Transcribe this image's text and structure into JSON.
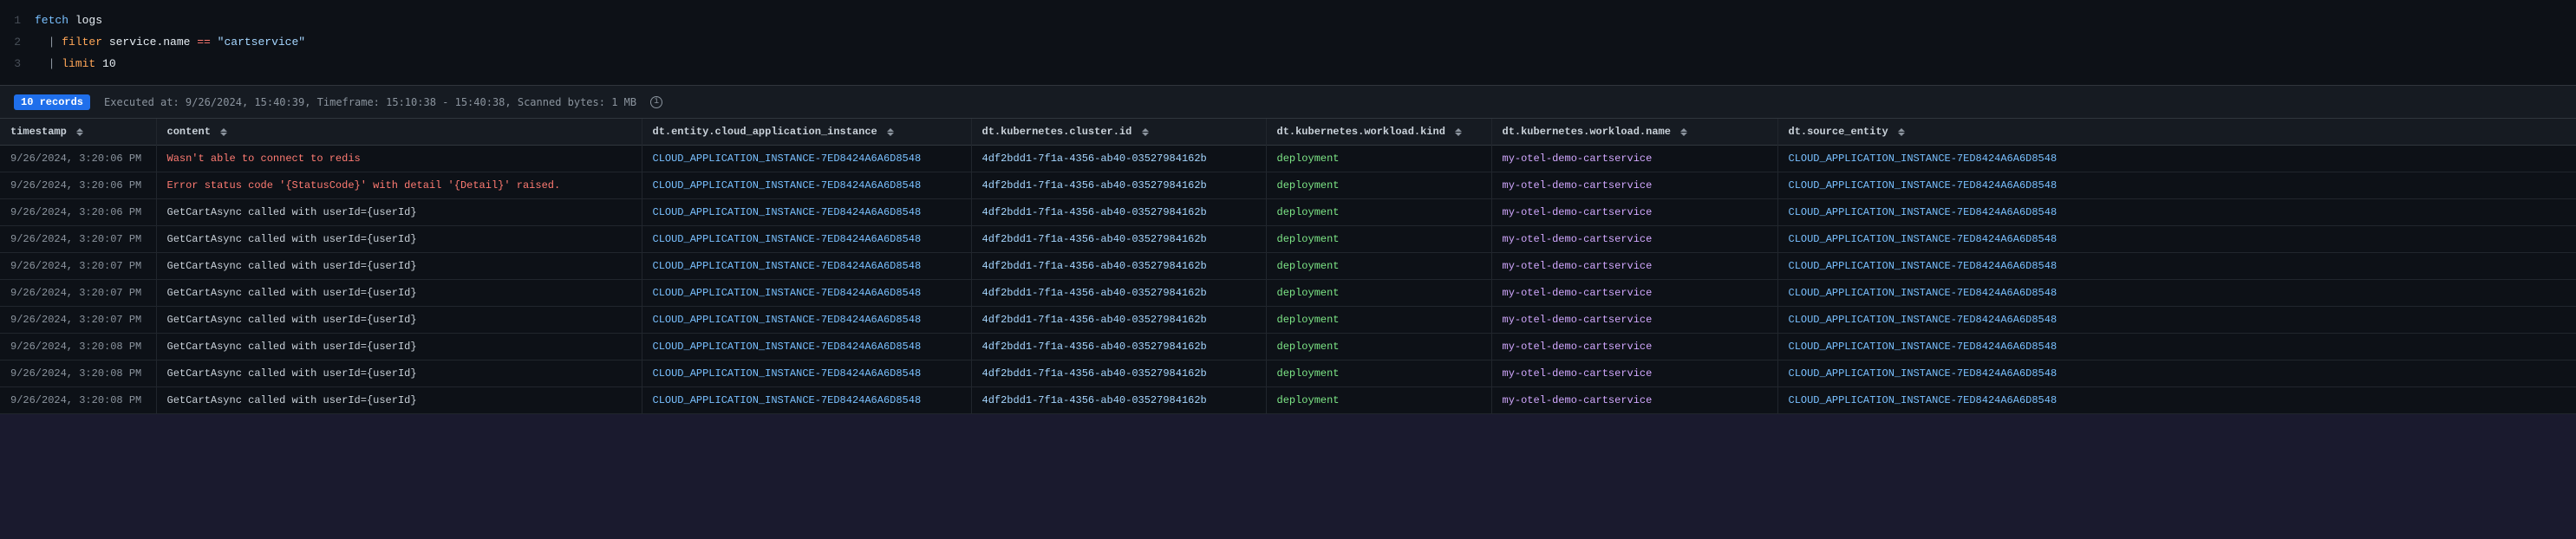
{
  "editor": {
    "lines": [
      {
        "number": "1",
        "tokens": [
          {
            "text": "fetch",
            "class": "kw-blue"
          },
          {
            "text": " logs",
            "class": "kw-white"
          }
        ]
      },
      {
        "number": "2",
        "tokens": [
          {
            "text": "  | ",
            "class": "kw-pipe"
          },
          {
            "text": "filter",
            "class": "kw-orange"
          },
          {
            "text": " service.name ",
            "class": "kw-white"
          },
          {
            "text": "==",
            "class": "kw-operator"
          },
          {
            "text": " \"cartservice\"",
            "class": "kw-string"
          }
        ]
      },
      {
        "number": "3",
        "tokens": [
          {
            "text": "  | ",
            "class": "kw-pipe"
          },
          {
            "text": "limit",
            "class": "kw-orange"
          },
          {
            "text": " 10",
            "class": "kw-white"
          }
        ]
      }
    ]
  },
  "statusBar": {
    "records": "10 records",
    "executed": "Executed at: 9/26/2024, 15:40:39, Timeframe: 15:10:38 - 15:40:38, Scanned bytes: 1 MB"
  },
  "table": {
    "columns": [
      {
        "id": "timestamp",
        "label": "timestamp"
      },
      {
        "id": "content",
        "label": "content"
      },
      {
        "id": "cloud_app",
        "label": "dt.entity.cloud_application_instance"
      },
      {
        "id": "cluster",
        "label": "dt.kubernetes.cluster.id"
      },
      {
        "id": "workload_kind",
        "label": "dt.kubernetes.workload.kind"
      },
      {
        "id": "workload_name",
        "label": "dt.kubernetes.workload.name"
      },
      {
        "id": "source",
        "label": "dt.source_entity"
      }
    ],
    "rows": [
      {
        "timestamp": "9/26/2024, 3:20:06 PM",
        "content": "Wasn't able to connect to redis",
        "cloud_app": "CLOUD_APPLICATION_INSTANCE-7ED8424A6A6D8548",
        "cluster": "4df2bdd1-7f1a-4356-ab40-03527984162b",
        "workload_kind": "deployment",
        "workload_name": "my-otel-demo-cartservice",
        "source": "CLOUD_APPLICATION_INSTANCE-7ED8424A6A6D8548"
      },
      {
        "timestamp": "9/26/2024, 3:20:06 PM",
        "content": "Error status code '{StatusCode}' with detail '{Detail}' raised.",
        "cloud_app": "CLOUD_APPLICATION_INSTANCE-7ED8424A6A6D8548",
        "cluster": "4df2bdd1-7f1a-4356-ab40-03527984162b",
        "workload_kind": "deployment",
        "workload_name": "my-otel-demo-cartservice",
        "source": "CLOUD_APPLICATION_INSTANCE-7ED8424A6A6D8548"
      },
      {
        "timestamp": "9/26/2024, 3:20:06 PM",
        "content": "GetCartAsync called with userId={userId}",
        "cloud_app": "CLOUD_APPLICATION_INSTANCE-7ED8424A6A6D8548",
        "cluster": "4df2bdd1-7f1a-4356-ab40-03527984162b",
        "workload_kind": "deployment",
        "workload_name": "my-otel-demo-cartservice",
        "source": "CLOUD_APPLICATION_INSTANCE-7ED8424A6A6D8548"
      },
      {
        "timestamp": "9/26/2024, 3:20:07 PM",
        "content": "GetCartAsync called with userId={userId}",
        "cloud_app": "CLOUD_APPLICATION_INSTANCE-7ED8424A6A6D8548",
        "cluster": "4df2bdd1-7f1a-4356-ab40-03527984162b",
        "workload_kind": "deployment",
        "workload_name": "my-otel-demo-cartservice",
        "source": "CLOUD_APPLICATION_INSTANCE-7ED8424A6A6D8548"
      },
      {
        "timestamp": "9/26/2024, 3:20:07 PM",
        "content": "GetCartAsync called with userId={userId}",
        "cloud_app": "CLOUD_APPLICATION_INSTANCE-7ED8424A6A6D8548",
        "cluster": "4df2bdd1-7f1a-4356-ab40-03527984162b",
        "workload_kind": "deployment",
        "workload_name": "my-otel-demo-cartservice",
        "source": "CLOUD_APPLICATION_INSTANCE-7ED8424A6A6D8548"
      },
      {
        "timestamp": "9/26/2024, 3:20:07 PM",
        "content": "GetCartAsync called with userId={userId}",
        "cloud_app": "CLOUD_APPLICATION_INSTANCE-7ED8424A6A6D8548",
        "cluster": "4df2bdd1-7f1a-4356-ab40-03527984162b",
        "workload_kind": "deployment",
        "workload_name": "my-otel-demo-cartservice",
        "source": "CLOUD_APPLICATION_INSTANCE-7ED8424A6A6D8548"
      },
      {
        "timestamp": "9/26/2024, 3:20:07 PM",
        "content": "GetCartAsync called with userId={userId}",
        "cloud_app": "CLOUD_APPLICATION_INSTANCE-7ED8424A6A6D8548",
        "cluster": "4df2bdd1-7f1a-4356-ab40-03527984162b",
        "workload_kind": "deployment",
        "workload_name": "my-otel-demo-cartservice",
        "source": "CLOUD_APPLICATION_INSTANCE-7ED8424A6A6D8548"
      },
      {
        "timestamp": "9/26/2024, 3:20:08 PM",
        "content": "GetCartAsync called with userId={userId}",
        "cloud_app": "CLOUD_APPLICATION_INSTANCE-7ED8424A6A6D8548",
        "cluster": "4df2bdd1-7f1a-4356-ab40-03527984162b",
        "workload_kind": "deployment",
        "workload_name": "my-otel-demo-cartservice",
        "source": "CLOUD_APPLICATION_INSTANCE-7ED8424A6A6D8548"
      },
      {
        "timestamp": "9/26/2024, 3:20:08 PM",
        "content": "GetCartAsync called with userId={userId}",
        "cloud_app": "CLOUD_APPLICATION_INSTANCE-7ED8424A6A6D8548",
        "cluster": "4df2bdd1-7f1a-4356-ab40-03527984162b",
        "workload_kind": "deployment",
        "workload_name": "my-otel-demo-cartservice",
        "source": "CLOUD_APPLICATION_INSTANCE-7ED8424A6A6D8548"
      },
      {
        "timestamp": "9/26/2024, 3:20:08 PM",
        "content": "GetCartAsync called with userId={userId}",
        "cloud_app": "CLOUD_APPLICATION_INSTANCE-7ED8424A6A6D8548",
        "cluster": "4df2bdd1-7f1a-4356-ab40-03527984162b",
        "workload_kind": "deployment",
        "workload_name": "my-otel-demo-cartservice",
        "source": "CLOUD_APPLICATION_INSTANCE-7ED8424A6A6D8548"
      }
    ]
  }
}
